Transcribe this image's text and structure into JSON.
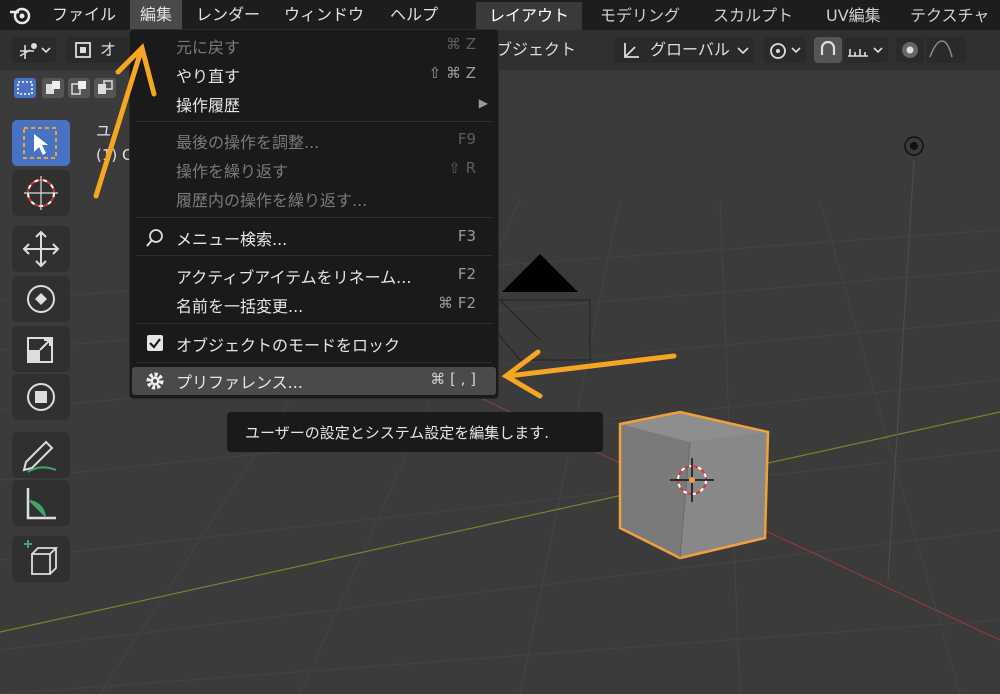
{
  "menubar": {
    "items": [
      "ファイル",
      "編集",
      "レンダー",
      "ウィンドウ",
      "ヘルプ"
    ],
    "workspaces": [
      "レイアウト",
      "モデリング",
      "スカルプト",
      "UV編集",
      "テクスチャ"
    ]
  },
  "header": {
    "mode_short": "オ",
    "object_menu": "ブジェクト",
    "transform_orientation": "グローバル"
  },
  "viewport_text": {
    "view_label": "ユ",
    "collection_label": "(1) C"
  },
  "edit_menu": {
    "items": [
      {
        "label": "元に戻す",
        "shortcut": "⌘ Z"
      },
      {
        "label": "やり直す",
        "shortcut": "⇧ ⌘ Z"
      },
      {
        "label": "操作履歴",
        "shortcut": "▶"
      },
      {
        "label": "最後の操作を調整...",
        "shortcut": "F9"
      },
      {
        "label": "操作を繰り返す",
        "shortcut": "⇧ R"
      },
      {
        "label": "履歴内の操作を繰り返す...",
        "shortcut": ""
      },
      {
        "label": "メニュー検索...",
        "shortcut": "F3"
      },
      {
        "label": "アクティブアイテムをリネーム...",
        "shortcut": "F2"
      },
      {
        "label": "名前を一括変更...",
        "shortcut": "⌘ F2"
      },
      {
        "label": "オブジェクトのモードをロック",
        "shortcut": ""
      },
      {
        "label": "プリファレンス...",
        "shortcut": "⌘ [ , ]"
      }
    ]
  },
  "tooltip": {
    "text": "ユーザーの設定とシステム設定を編集します."
  },
  "colors": {
    "accent_blue": "#4872c4",
    "arrow_orange": "#f5a623",
    "selection_orange": "#f0a13c"
  }
}
